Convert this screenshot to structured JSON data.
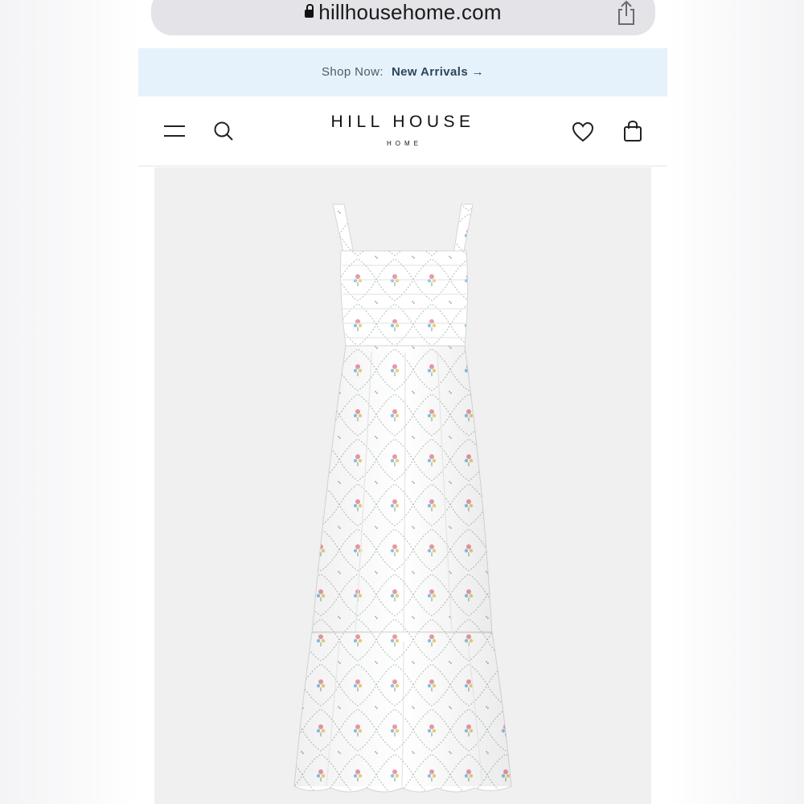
{
  "browser": {
    "url": "hillhousehome.com",
    "icons": [
      "lock-icon",
      "share-icon"
    ]
  },
  "banner": {
    "prefix": "Shop Now:",
    "link_label": "New Arrivals",
    "arrow": "→"
  },
  "header": {
    "logo_main": "HILL HOUSE",
    "logo_sub": "HOME",
    "icons": [
      "menu-icon",
      "search-icon",
      "heart-icon",
      "shopping-bag-icon"
    ]
  },
  "product": {
    "image": "white floral print smocked maxi dress",
    "colors": {
      "background": "#f0f0f0",
      "dress": "#ffffff",
      "print_pink": "#e89aa7",
      "print_blue": "#8cc3e0",
      "print_green": "#8fb39a",
      "print_yellow": "#e8cf7a"
    }
  }
}
